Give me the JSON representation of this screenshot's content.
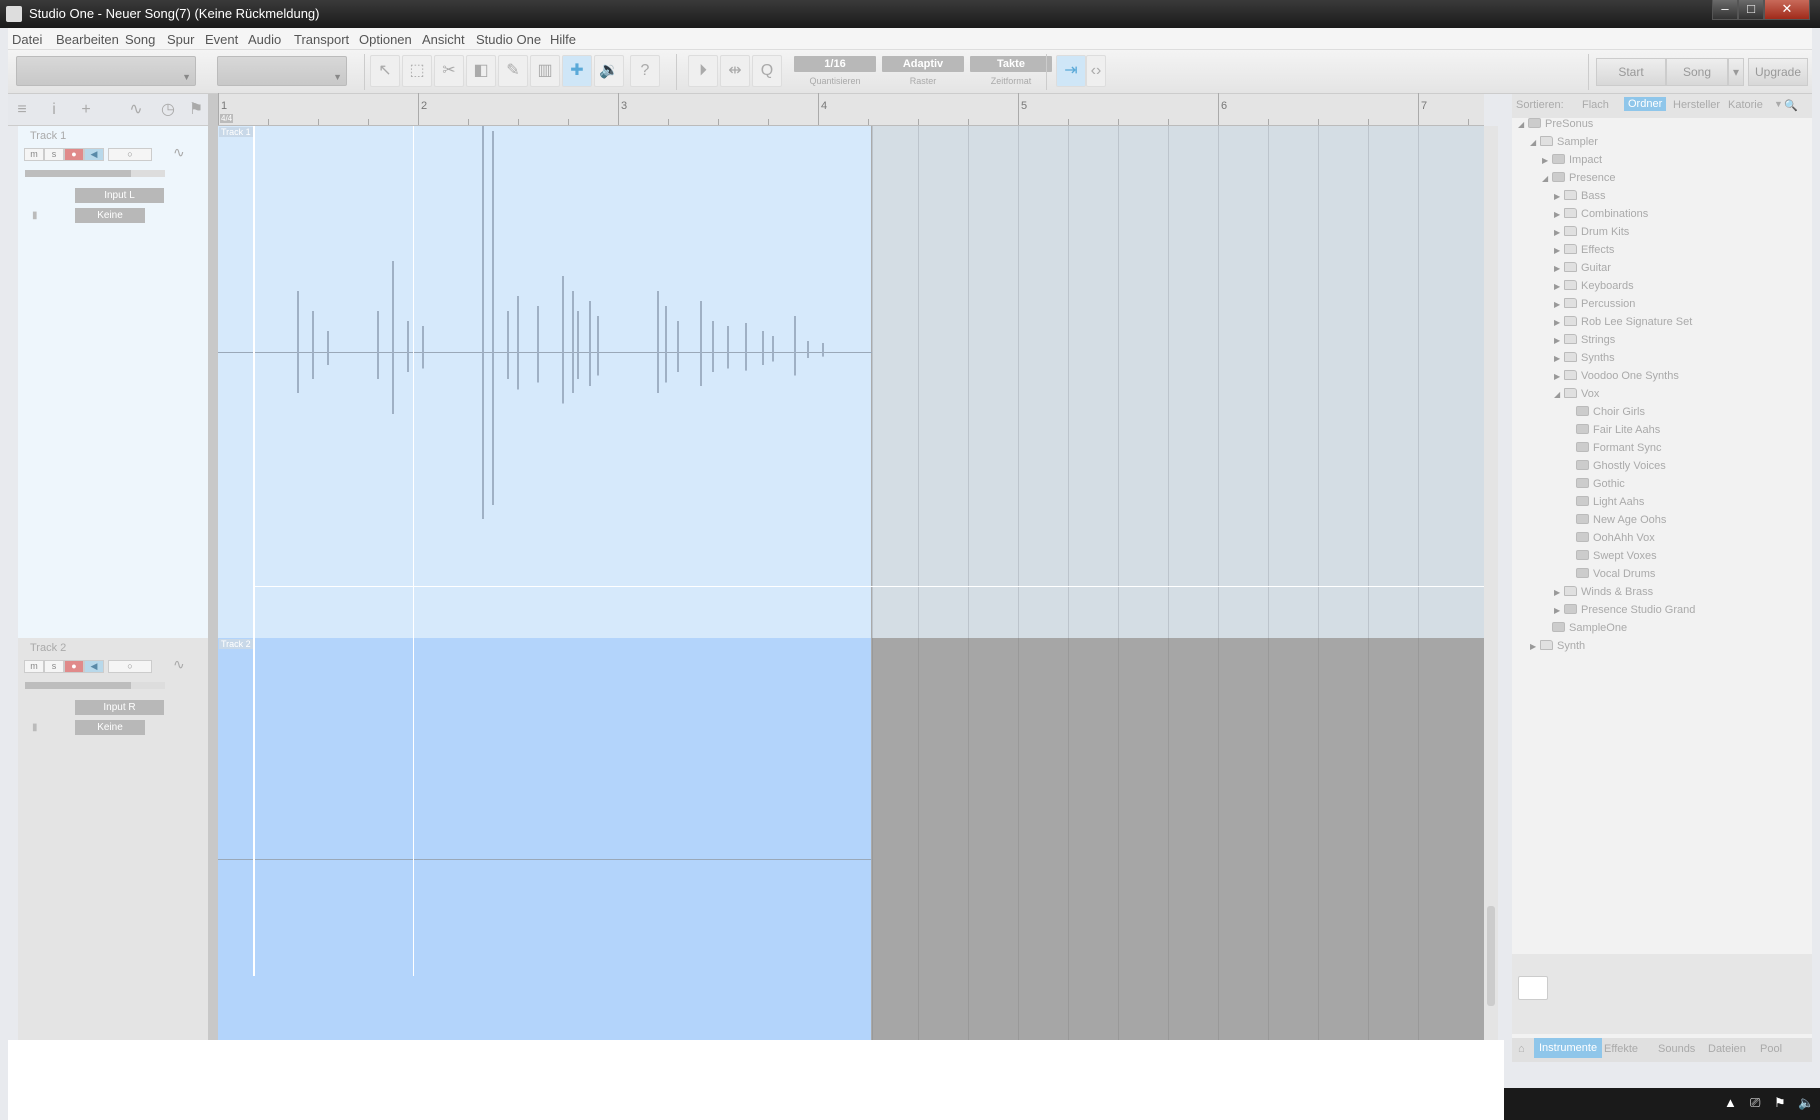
{
  "window": {
    "title": "Studio One - Neuer Song(7) (Keine Rückmeldung)",
    "minimize": "–",
    "maximize": "□",
    "close": "✕"
  },
  "menu": [
    "Datei",
    "Bearbeiten",
    "Song",
    "Spur",
    "Event",
    "Audio",
    "Transport",
    "Optionen",
    "Ansicht",
    "Studio One",
    "Hilfe"
  ],
  "toolbar": {
    "quantize": {
      "value": "1/16",
      "label": "Quantisieren"
    },
    "snap": {
      "value": "Adaptiv",
      "label": "Raster"
    },
    "timeformat": {
      "value": "Takte",
      "label": "Zeitformat"
    },
    "start": "Start",
    "song": "Song",
    "upgrade": "Upgrade",
    "help": "?"
  },
  "ruler": {
    "signature": "4/4",
    "bars": [
      "1",
      "2",
      "3",
      "4",
      "5",
      "6",
      "7"
    ]
  },
  "tracks": [
    {
      "name": "Track 1",
      "input": "Input L",
      "output": "Keine",
      "event": "Track 1"
    },
    {
      "name": "Track 2",
      "input": "Input R",
      "output": "Keine",
      "event": "Track 2"
    }
  ],
  "track_buttons": {
    "mute": "m",
    "solo": "s",
    "rec": "●",
    "monitor": "◀",
    "auto": "○"
  },
  "browser": {
    "sort_label": "Sortieren:",
    "sort_options": [
      "Flach",
      "Ordner",
      "Hersteller",
      "Katorie"
    ],
    "sort_active": "Ordner",
    "tree": [
      {
        "label": "PreSonus",
        "level": 0,
        "icon": "patch",
        "open": true
      },
      {
        "label": "Sampler",
        "level": 1,
        "icon": "folder",
        "open": true
      },
      {
        "label": "Impact",
        "level": 2,
        "icon": "patch",
        "open": false
      },
      {
        "label": "Presence",
        "level": 2,
        "icon": "patch",
        "open": true
      },
      {
        "label": "Bass",
        "level": 3,
        "icon": "folder",
        "open": false
      },
      {
        "label": "Combinations",
        "level": 3,
        "icon": "folder",
        "open": false
      },
      {
        "label": "Drum Kits",
        "level": 3,
        "icon": "folder",
        "open": false
      },
      {
        "label": "Effects",
        "level": 3,
        "icon": "folder",
        "open": false
      },
      {
        "label": "Guitar",
        "level": 3,
        "icon": "folder",
        "open": false
      },
      {
        "label": "Keyboards",
        "level": 3,
        "icon": "folder",
        "open": false
      },
      {
        "label": "Percussion",
        "level": 3,
        "icon": "folder",
        "open": false
      },
      {
        "label": "Rob Lee Signature Set",
        "level": 3,
        "icon": "folder",
        "open": false
      },
      {
        "label": "Strings",
        "level": 3,
        "icon": "folder",
        "open": false
      },
      {
        "label": "Synths",
        "level": 3,
        "icon": "folder",
        "open": false
      },
      {
        "label": "Voodoo One Synths",
        "level": 3,
        "icon": "folder",
        "open": false
      },
      {
        "label": "Vox",
        "level": 3,
        "icon": "folder",
        "open": true
      },
      {
        "label": "Choir Girls",
        "level": 4,
        "icon": "patch",
        "open": null
      },
      {
        "label": "Fair Lite Aahs",
        "level": 4,
        "icon": "patch",
        "open": null
      },
      {
        "label": "Formant Sync",
        "level": 4,
        "icon": "patch",
        "open": null
      },
      {
        "label": "Ghostly Voices",
        "level": 4,
        "icon": "patch",
        "open": null
      },
      {
        "label": "Gothic",
        "level": 4,
        "icon": "patch",
        "open": null
      },
      {
        "label": "Light Aahs",
        "level": 4,
        "icon": "patch",
        "open": null
      },
      {
        "label": "New Age Oohs",
        "level": 4,
        "icon": "patch",
        "open": null
      },
      {
        "label": "OohAhh Vox",
        "level": 4,
        "icon": "patch",
        "open": null
      },
      {
        "label": "Swept Voxes",
        "level": 4,
        "icon": "patch",
        "open": null
      },
      {
        "label": "Vocal Drums",
        "level": 4,
        "icon": "patch",
        "open": null
      },
      {
        "label": "Winds & Brass",
        "level": 3,
        "icon": "folder",
        "open": false
      },
      {
        "label": "Presence Studio Grand",
        "level": 3,
        "icon": "patch",
        "open": false
      },
      {
        "label": "SampleOne",
        "level": 2,
        "icon": "patch",
        "open": null
      },
      {
        "label": "Synth",
        "level": 1,
        "icon": "folder",
        "open": false
      }
    ],
    "tabs": [
      "Instrumente",
      "Effekte",
      "Sounds",
      "Dateien",
      "Pool"
    ],
    "tab_active": "Instrumente"
  },
  "taskbar": {
    "icons": [
      "▲",
      "⎚",
      "⚑",
      "🔈"
    ]
  }
}
